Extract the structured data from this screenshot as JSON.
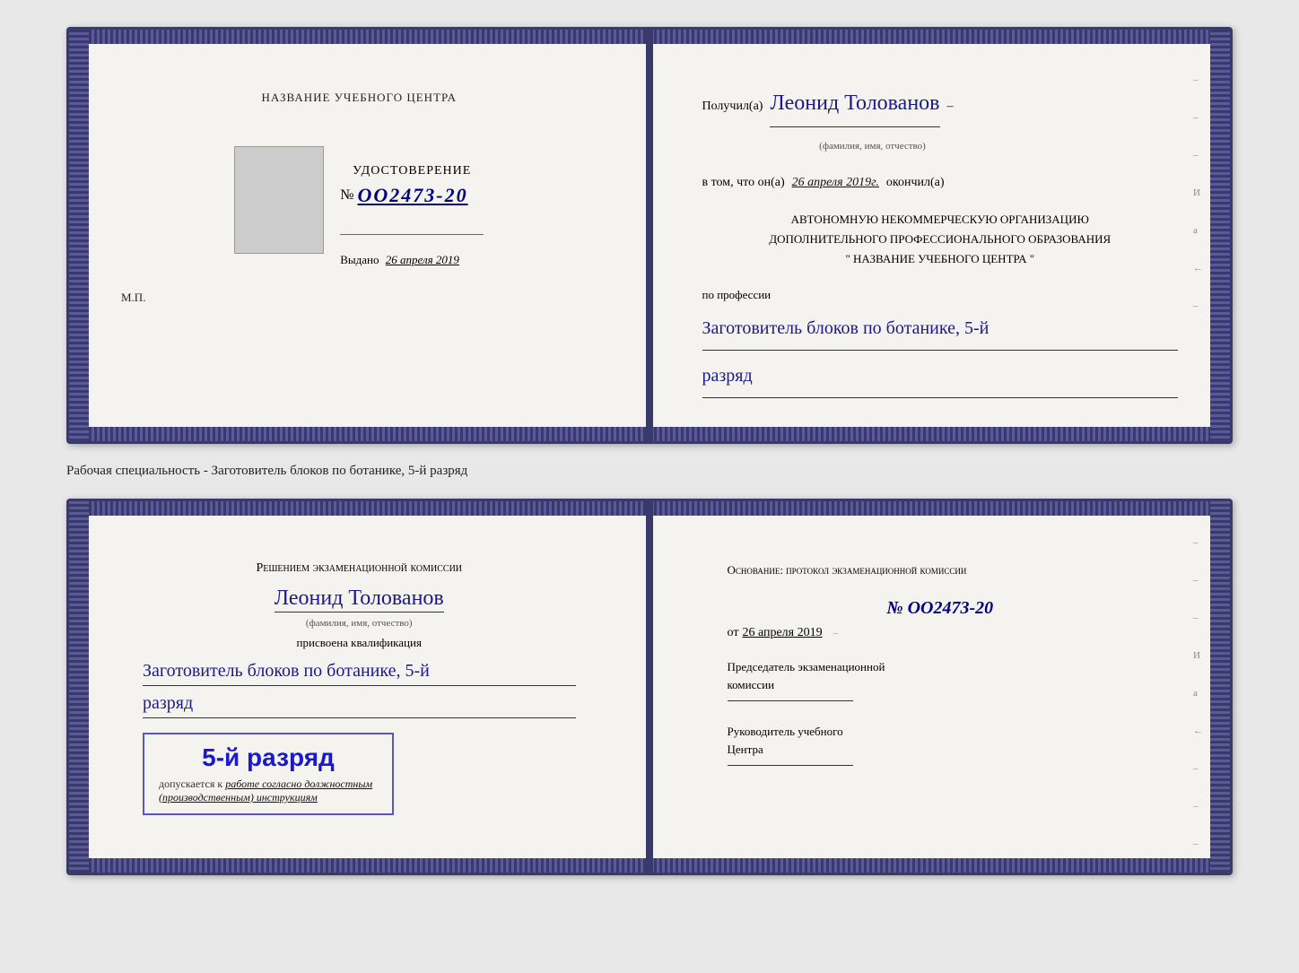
{
  "top_doc": {
    "left": {
      "training_center_label": "НАЗВАНИЕ УЧЕБНОГО ЦЕНТРА",
      "cert_label": "УДОСТОВЕРЕНИЕ",
      "cert_num_prefix": "№",
      "cert_num": "OO2473-20",
      "issued_label": "Выдано",
      "issued_date": "26 апреля 2019",
      "mp_label": "М.П."
    },
    "right": {
      "received_prefix": "Получил(а)",
      "recipient_name": "Леонид Толованов",
      "fio_label": "(фамилия, имя, отчество)",
      "date_prefix": "в том, что он(а)",
      "date_value": "26 апреля 2019г.",
      "finished_label": "окончил(а)",
      "org_line1": "АВТОНОМНУЮ НЕКОММЕРЧЕСКУЮ ОРГАНИЗАЦИЮ",
      "org_line2": "ДОПОЛНИТЕЛЬНОГО ПРОФЕССИОНАЛЬНОГО ОБРАЗОВАНИЯ",
      "org_line3": "\"   НАЗВАНИЕ УЧЕБНОГО ЦЕНТРА   \"",
      "profession_label": "по профессии",
      "profession_value": "Заготовитель блоков по ботанике, 5-й",
      "razryad_value": "разряд",
      "dash": "–"
    }
  },
  "between_label": "Рабочая специальность - Заготовитель блоков по ботанике, 5-й разряд",
  "bottom_doc": {
    "left": {
      "commission_text": "Решением экзаменационной комиссии",
      "name": "Леонид Толованов",
      "fio_label": "(фамилия, имя, отчество)",
      "prisvoena_label": "присвоена квалификация",
      "qualification": "Заготовитель блоков по ботанике, 5-й",
      "razryad": "разряд",
      "grade_display": "5-й разряд",
      "dopuskaetsya": "допускается к",
      "work_text": "работе согласно должностным",
      "instructions_text": "(производственным) инструкциям"
    },
    "right": {
      "osnov_label": "Основание: протокол экзаменационной комиссии",
      "protocol_num": "№  OO2473-20",
      "ot_prefix": "от",
      "ot_date": "26 апреля 2019",
      "chairman_label": "Председатель экзаменационной",
      "chairman_label2": "комиссии",
      "head_label": "Руководитель учебного",
      "head_label2": "Центра",
      "dash1": "–",
      "dash2": "–",
      "dash3": "–",
      "И": "И",
      "а": "а",
      "left_arrow": "←"
    }
  }
}
